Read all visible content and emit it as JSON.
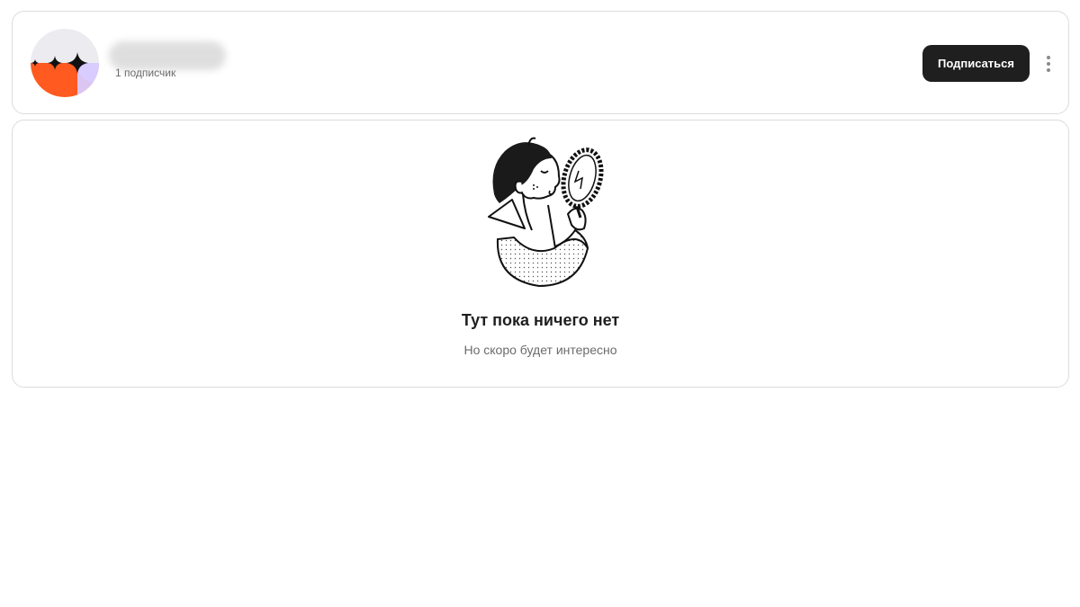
{
  "profile": {
    "subscribers_label": "1 подписчик",
    "subscribe_button": "Подписаться",
    "avatar_colors": {
      "top": "#ececf0",
      "bottom": "#ff5a1f",
      "accent": "#d9cbff",
      "stars": "#111111"
    }
  },
  "empty_state": {
    "title": "Тут пока ничего нет",
    "subtitle": "Но скоро будет интересно"
  },
  "icons": {
    "more": "vertical-dots-icon",
    "illustration": "man-with-mirror-illustration"
  },
  "colors": {
    "button_bg": "#1f1f1f",
    "button_text": "#ffffff",
    "border": "#dcdcdc",
    "muted_text": "#6b6b6b"
  }
}
